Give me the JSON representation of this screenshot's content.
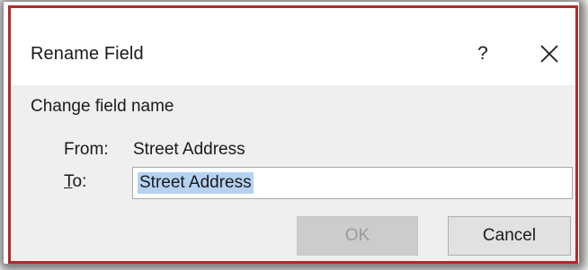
{
  "dialog": {
    "title": "Rename Field",
    "help_glyph": "?",
    "close_icon": "close-icon",
    "section_label": "Change field name",
    "from": {
      "label": "From:",
      "value": "Street Address"
    },
    "to": {
      "label_prefix": "T",
      "label_rest": "o:",
      "value": "Street Address"
    },
    "buttons": {
      "ok": "OK",
      "cancel": "Cancel"
    },
    "colors": {
      "frame_border": "#b32a2a",
      "selection": "#b5d2f3",
      "body_bg": "#efefef"
    }
  }
}
